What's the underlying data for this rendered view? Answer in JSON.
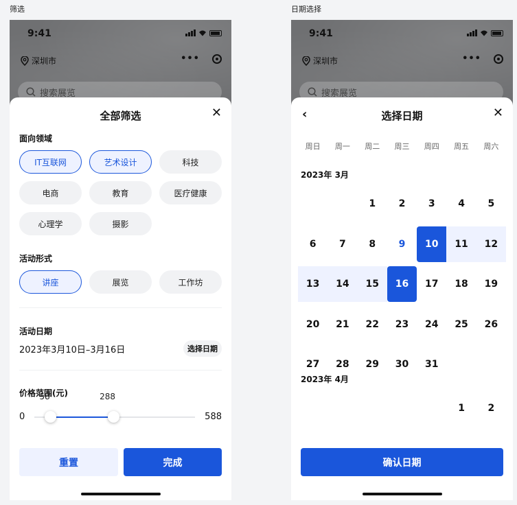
{
  "captions": {
    "left": "筛选",
    "right": "日期选择"
  },
  "status_bar": {
    "time": "9:41"
  },
  "background_app": {
    "location": "深圳市",
    "search_placeholder": "搜索展览",
    "more": "•••"
  },
  "filter_sheet": {
    "title": "全部筛选",
    "close": "✕",
    "field": {
      "title": "面向领域",
      "options": [
        {
          "label": "IT互联网",
          "selected": true
        },
        {
          "label": "艺术设计",
          "selected": true
        },
        {
          "label": "科技",
          "selected": false
        },
        {
          "label": "电商",
          "selected": false
        },
        {
          "label": "教育",
          "selected": false
        },
        {
          "label": "医疗健康",
          "selected": false
        },
        {
          "label": "心理学",
          "selected": false
        },
        {
          "label": "摄影",
          "selected": false
        }
      ]
    },
    "format": {
      "title": "活动形式",
      "options": [
        {
          "label": "讲座",
          "selected": true
        },
        {
          "label": "展览",
          "selected": false
        },
        {
          "label": "工作坊",
          "selected": false
        }
      ]
    },
    "date": {
      "title": "活动日期",
      "value": "2023年3月10日–3月16日",
      "button": "选择日期"
    },
    "price": {
      "title": "价格范围(元)",
      "min": 0,
      "max": 588,
      "low": 58,
      "high": 288
    },
    "buttons": {
      "reset": "重置",
      "done": "完成"
    }
  },
  "date_sheet": {
    "title": "选择日期",
    "back": "‹",
    "close": "✕",
    "weekdays": [
      "周日",
      "周一",
      "周二",
      "周三",
      "周四",
      "周五",
      "周六"
    ],
    "months": [
      {
        "label": "2023年 3月",
        "weeks": [
          [
            "",
            "",
            "1",
            "2",
            "3",
            "4",
            "5"
          ],
          [
            "6",
            "7",
            "8",
            "9",
            "10",
            "11",
            "12"
          ],
          [
            "13",
            "14",
            "15",
            "16",
            "17",
            "18",
            "19"
          ],
          [
            "20",
            "21",
            "22",
            "23",
            "24",
            "25",
            "26"
          ],
          [
            "27",
            "28",
            "29",
            "30",
            "31",
            "",
            ""
          ]
        ]
      },
      {
        "label": "2023年 4月",
        "weeks": [
          [
            "",
            "",
            "",
            "",
            "",
            "1",
            "2"
          ]
        ]
      }
    ],
    "today": "9",
    "range_start": "10",
    "range_end": "16",
    "confirm": "确认日期"
  },
  "colors": {
    "accent": "#1a56db",
    "accent_light": "#eef2ff",
    "chip_bg": "#f1f2f4"
  }
}
